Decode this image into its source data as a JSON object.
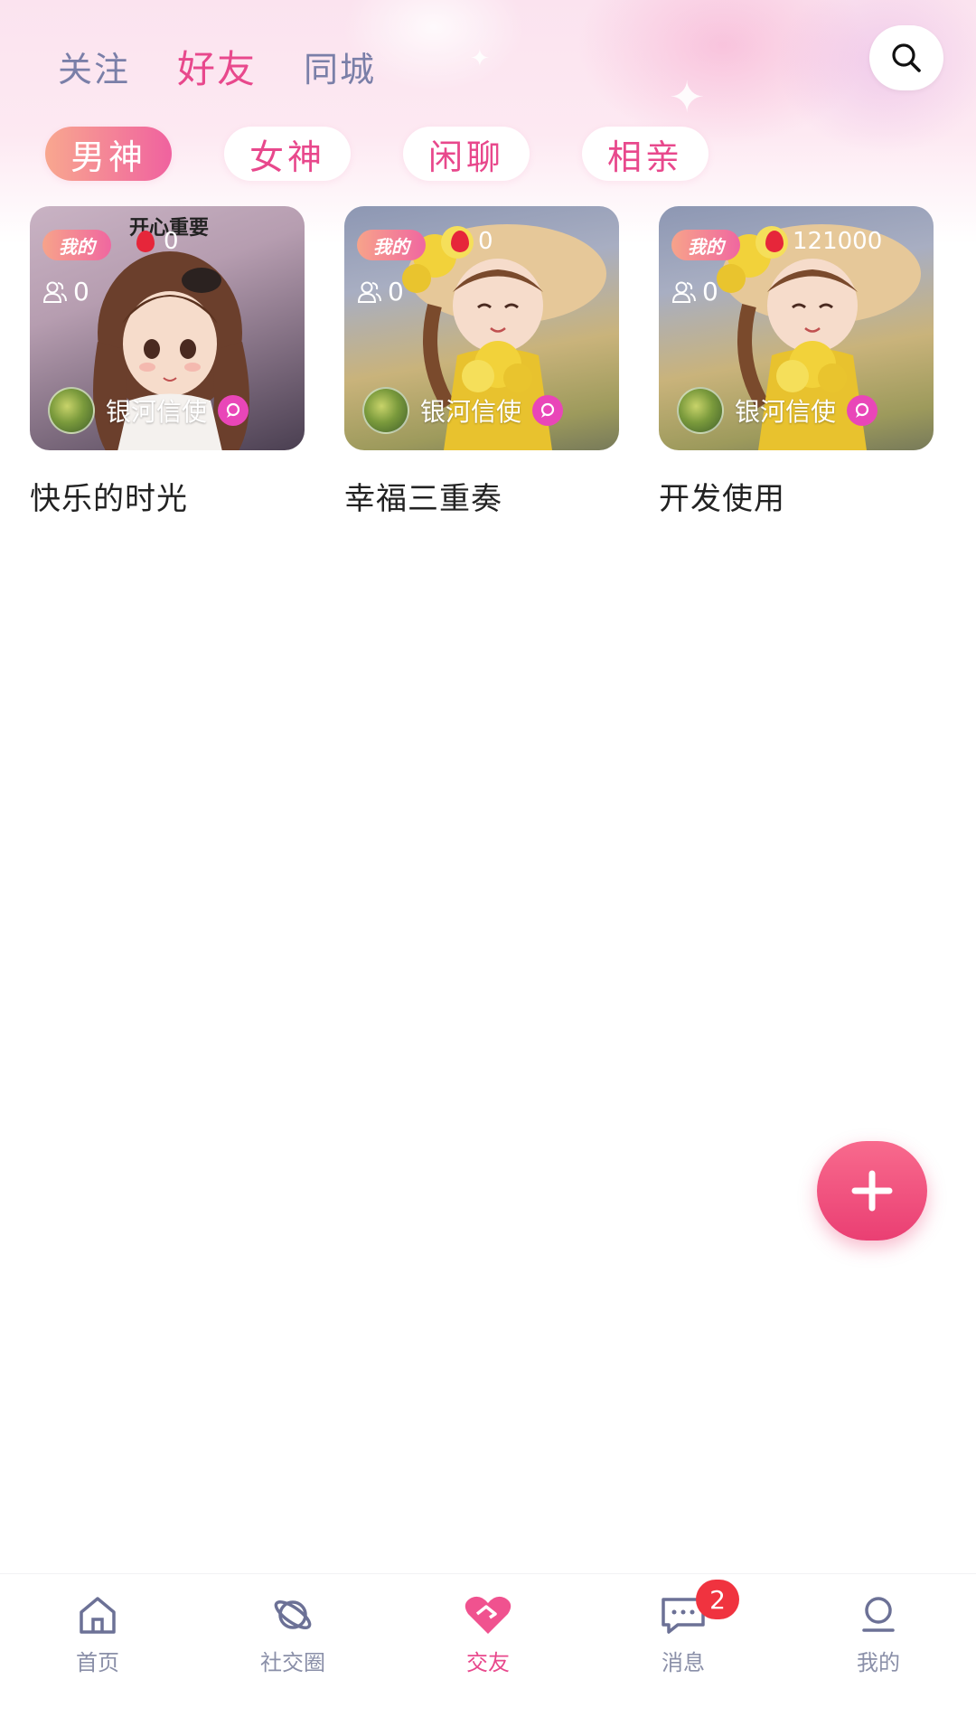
{
  "header": {
    "tabs": [
      {
        "label": "关注",
        "active": false
      },
      {
        "label": "好友",
        "active": true
      },
      {
        "label": "同城",
        "active": false
      }
    ],
    "search_icon": "search-icon"
  },
  "categories": [
    {
      "label": "男神",
      "active": true
    },
    {
      "label": "女神",
      "active": false
    },
    {
      "label": "闲聊",
      "active": false
    },
    {
      "label": "相亲",
      "active": false
    }
  ],
  "cards": [
    {
      "badge": "我的",
      "gifts": "0",
      "members": "0",
      "owner": "银河信使",
      "title": "快乐的时光",
      "image_caption": "开心重要"
    },
    {
      "badge": "我的",
      "gifts": "0",
      "members": "0",
      "owner": "银河信使",
      "title": "幸福三重奏"
    },
    {
      "badge": "我的",
      "gifts": "121000",
      "members": "0",
      "owner": "银河信使",
      "title": "开发使用"
    }
  ],
  "fab": {
    "icon": "plus-icon"
  },
  "bottom_nav": [
    {
      "label": "首页",
      "icon": "home-icon",
      "active": false
    },
    {
      "label": "社交圈",
      "icon": "planet-icon",
      "active": false
    },
    {
      "label": "交友",
      "icon": "heart-handshake-icon",
      "active": true
    },
    {
      "label": "消息",
      "icon": "message-icon",
      "active": false,
      "badge": "2"
    },
    {
      "label": "我的",
      "icon": "profile-icon",
      "active": false
    }
  ],
  "colors": {
    "accent": "#e8488c",
    "inactive": "#7a7fa8",
    "badge": "#f0333f"
  }
}
